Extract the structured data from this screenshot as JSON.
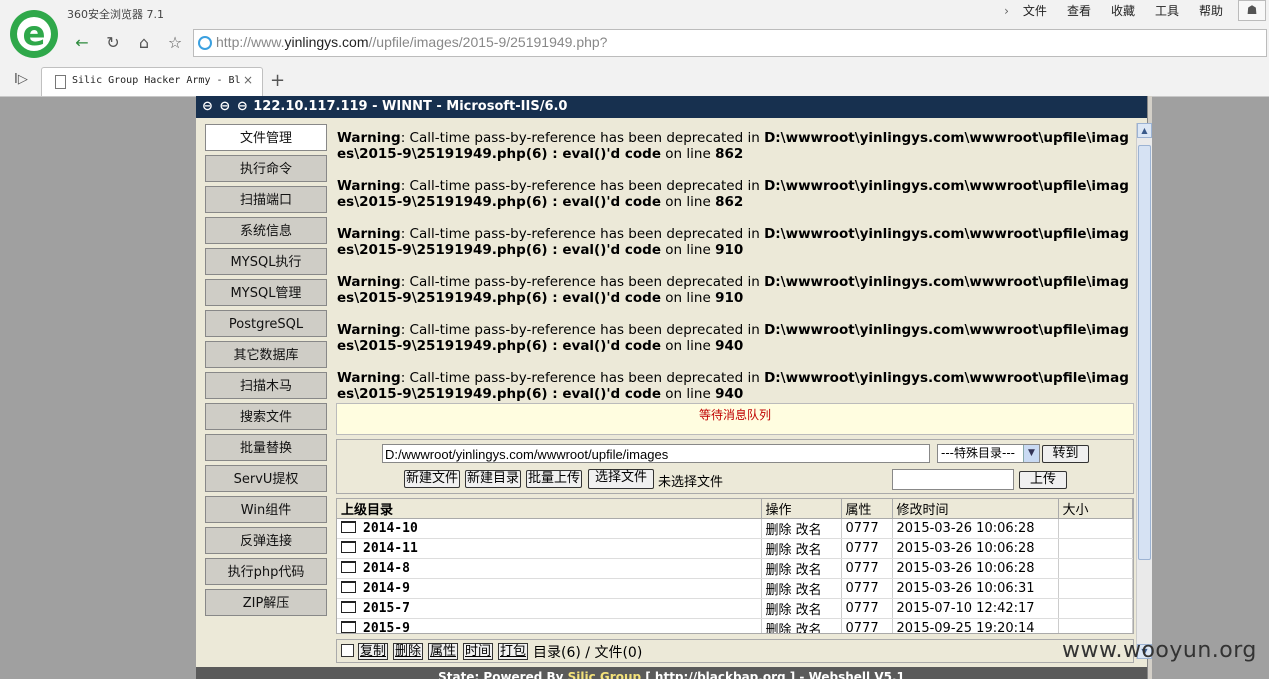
{
  "browser": {
    "brand": "360安全浏览器 7.1",
    "menus": [
      "文件",
      "查看",
      "收藏",
      "工具",
      "帮助"
    ],
    "url_prefix": "http://www.",
    "url_host": "yinlingys.com",
    "url_path": "//upfile/images/2015-9/25191949.php?",
    "tab_title": "Silic Group Hacker Army - Bl",
    "tab_close": "×",
    "new_tab": "+"
  },
  "shell": {
    "header": "122.10.117.119 - WINNT - Microsoft-IIS/6.0",
    "sidebar": [
      "文件管理",
      "执行命令",
      "扫描端口",
      "系统信息",
      "MYSQL执行",
      "MYSQL管理",
      "PostgreSQL",
      "其它数据库",
      "扫描木马",
      "搜索文件",
      "批量替换",
      "ServU提权",
      "Win组件",
      "反弹连接",
      "执行php代码",
      "ZIP解压"
    ],
    "warnings": [
      {
        "label": "Warning",
        "text": ": Call-time pass-by-reference has been deprecated in ",
        "file": "D:\\wwwroot\\yinlingys.com\\wwwroot\\upfile\\images\\2015-9\\25191949.php(6) : eval()'d code",
        "online": " on line ",
        "line": "862"
      },
      {
        "label": "Warning",
        "text": ": Call-time pass-by-reference has been deprecated in ",
        "file": "D:\\wwwroot\\yinlingys.com\\wwwroot\\upfile\\images\\2015-9\\25191949.php(6) : eval()'d code",
        "online": " on line ",
        "line": "862"
      },
      {
        "label": "Warning",
        "text": ": Call-time pass-by-reference has been deprecated in ",
        "file": "D:\\wwwroot\\yinlingys.com\\wwwroot\\upfile\\images\\2015-9\\25191949.php(6) : eval()'d code",
        "online": " on line ",
        "line": "910"
      },
      {
        "label": "Warning",
        "text": ": Call-time pass-by-reference has been deprecated in ",
        "file": "D:\\wwwroot\\yinlingys.com\\wwwroot\\upfile\\images\\2015-9\\25191949.php(6) : eval()'d code",
        "online": " on line ",
        "line": "910"
      },
      {
        "label": "Warning",
        "text": ": Call-time pass-by-reference has been deprecated in ",
        "file": "D:\\wwwroot\\yinlingys.com\\wwwroot\\upfile\\images\\2015-9\\25191949.php(6) : eval()'d code",
        "online": " on line ",
        "line": "940"
      },
      {
        "label": "Warning",
        "text": ": Call-time pass-by-reference has been deprecated in ",
        "file": "D:\\wwwroot\\yinlingys.com\\wwwroot\\upfile\\images\\2015-9\\25191949.php(6) : eval()'d code",
        "online": " on line ",
        "line": "940"
      }
    ],
    "queue": "等待消息队列",
    "path": "D:/wwwroot/yinlingys.com/wwwroot/upfile/images",
    "special_dir": "---特殊目录---",
    "goto": "转到",
    "new_file": "新建文件",
    "new_dir": "新建目录",
    "batch_upload": "批量上传",
    "choose_file": "选择文件",
    "no_file": "未选择文件",
    "upload": "上传",
    "columns": [
      "上级目录",
      "操作",
      "属性",
      "修改时间",
      "大小"
    ],
    "rows": [
      {
        "name": "2014-10",
        "ops": "删除 改名",
        "perm": "0777",
        "mtime": "2015-03-26 10:06:28",
        "size": ""
      },
      {
        "name": "2014-11",
        "ops": "删除 改名",
        "perm": "0777",
        "mtime": "2015-03-26 10:06:28",
        "size": ""
      },
      {
        "name": "2014-8",
        "ops": "删除 改名",
        "perm": "0777",
        "mtime": "2015-03-26 10:06:28",
        "size": ""
      },
      {
        "name": "2014-9",
        "ops": "删除 改名",
        "perm": "0777",
        "mtime": "2015-03-26 10:06:31",
        "size": ""
      },
      {
        "name": "2015-7",
        "ops": "删除 改名",
        "perm": "0777",
        "mtime": "2015-07-10 12:42:17",
        "size": ""
      },
      {
        "name": "2015-9",
        "ops": "删除 改名",
        "perm": "0777",
        "mtime": "2015-09-25 19:20:14",
        "size": ""
      }
    ],
    "bottom_buttons": [
      "复制",
      "删除",
      "属性",
      "时间",
      "打包"
    ],
    "counts": "目录(6) / 文件(0)",
    "status_pre": "State: Powered By ",
    "status_link": "Silic Group",
    "status_post": " [ http://blackbap.org ] - Webshell V5.1"
  },
  "watermark": "www.wooyun.org"
}
